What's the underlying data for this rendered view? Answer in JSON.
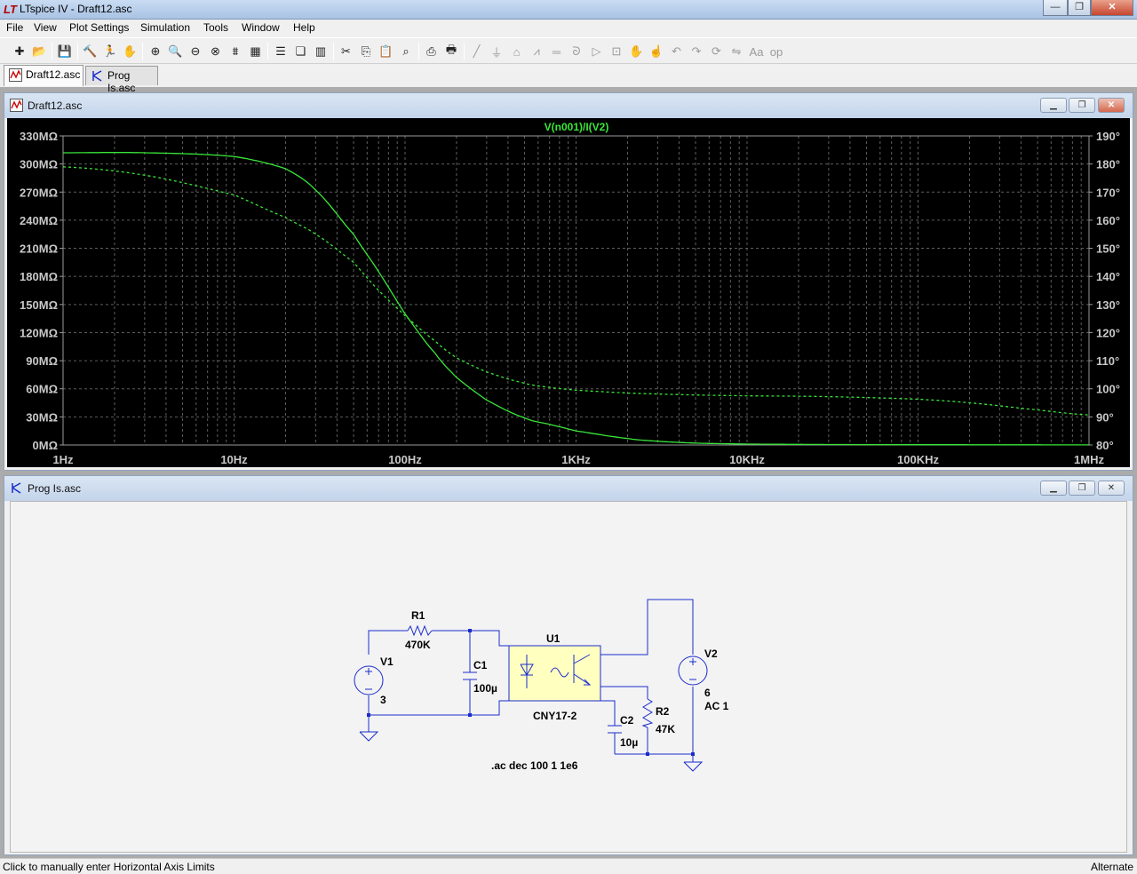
{
  "app": {
    "title": "LTspice IV - Draft12.asc",
    "logo": "LT"
  },
  "menu": [
    {
      "label": "File"
    },
    {
      "label": "View"
    },
    {
      "label": "Plot Settings"
    },
    {
      "label": "Simulation"
    },
    {
      "label": "Tools"
    },
    {
      "label": "Window"
    },
    {
      "label": "Help"
    }
  ],
  "toolbar_icons": [
    "new-schematic-icon",
    "open-icon",
    "save-icon",
    "control-panel-icon",
    "run-icon",
    "halt-icon",
    "zoom-in-icon",
    "zoom-area-icon",
    "zoom-out-icon",
    "zoom-fit-icon",
    "autorange-icon",
    "grid-icon",
    "tile-horizontal-icon",
    "cascade-icon",
    "tile-vertical-icon",
    "cut-icon",
    "copy-icon",
    "paste-icon",
    "find-icon",
    "print-preview-icon",
    "print-icon",
    "wire-icon",
    "ground-icon",
    "label-icon",
    "resistor-icon",
    "capacitor-icon",
    "inductor-icon",
    "diode-icon",
    "component-icon",
    "move-icon",
    "drag-icon",
    "undo-icon",
    "redo-icon",
    "rotate-icon",
    "mirror-icon",
    "text-icon",
    "spice-directive-icon"
  ],
  "tabs": [
    {
      "label": "Draft12.asc",
      "active": true
    },
    {
      "label": "Prog Is.asc",
      "active": false
    }
  ],
  "plot_window": {
    "title": "Draft12.asc",
    "trace_label": "V(n001)/I(V2)",
    "trace_color": "#39e639"
  },
  "schematic_window": {
    "title": "Prog Is.asc",
    "wire_color": "#1a2ccc",
    "components": {
      "r1_name": "R1",
      "r1_value": "470K",
      "v1_name": "V1",
      "v1_value": "3",
      "c1_name": "C1",
      "c1_value": "100µ",
      "u1_name": "U1",
      "u1_model": "CNY17-2",
      "c2_name": "C2",
      "c2_value": "10µ",
      "r2_name": "R2",
      "r2_value": "47K",
      "v2_name": "V2",
      "v2_value": "6",
      "v2_ac": "AC 1"
    },
    "directive": ".ac dec 100 1 1e6"
  },
  "status": {
    "message": "Click to manually enter Horizontal Axis Limits",
    "mode": "Alternate"
  },
  "chart_data": {
    "type": "line",
    "title": "V(n001)/I(V2)",
    "xscale": "log",
    "xlim": [
      1,
      1000000
    ],
    "x_ticks": [
      "1Hz",
      "10Hz",
      "100Hz",
      "1KHz",
      "10KHz",
      "100KHz",
      "1MHz"
    ],
    "ylim": [
      0,
      330
    ],
    "y_ticks": [
      "0MΩ",
      "30MΩ",
      "60MΩ",
      "90MΩ",
      "120MΩ",
      "150MΩ",
      "180MΩ",
      "210MΩ",
      "240MΩ",
      "270MΩ",
      "300MΩ",
      "330MΩ"
    ],
    "y2lim": [
      80,
      190
    ],
    "y2_ticks": [
      "80°",
      "90°",
      "100°",
      "110°",
      "120°",
      "130°",
      "140°",
      "150°",
      "160°",
      "170°",
      "180°",
      "190°"
    ],
    "grid": true,
    "series": [
      {
        "name": "magnitude",
        "style": "solid",
        "axis": "left",
        "x": [
          1,
          3,
          10,
          20,
          30,
          50,
          70,
          100,
          150,
          200,
          300,
          500,
          700,
          1000,
          2000,
          3000,
          5000,
          10000,
          30000,
          100000,
          1000000
        ],
        "values": [
          312,
          312,
          308,
          295,
          272,
          225,
          185,
          140,
          98,
          72,
          48,
          29,
          22,
          15,
          7,
          4,
          2,
          1,
          0.5,
          0.3,
          0.1
        ]
      },
      {
        "name": "phase",
        "style": "dashed",
        "axis": "right",
        "x": [
          1,
          3,
          10,
          20,
          30,
          50,
          70,
          100,
          150,
          200,
          300,
          500,
          700,
          1000,
          2000,
          5000,
          10000,
          30000,
          100000,
          200000,
          500000,
          1000000
        ],
        "values": [
          179,
          176,
          169,
          161,
          155,
          145,
          135,
          126,
          117,
          111,
          106,
          102,
          100.5,
          99.5,
          98.5,
          97.8,
          97.5,
          97.2,
          96.3,
          95,
          92.5,
          90.7
        ]
      }
    ]
  }
}
